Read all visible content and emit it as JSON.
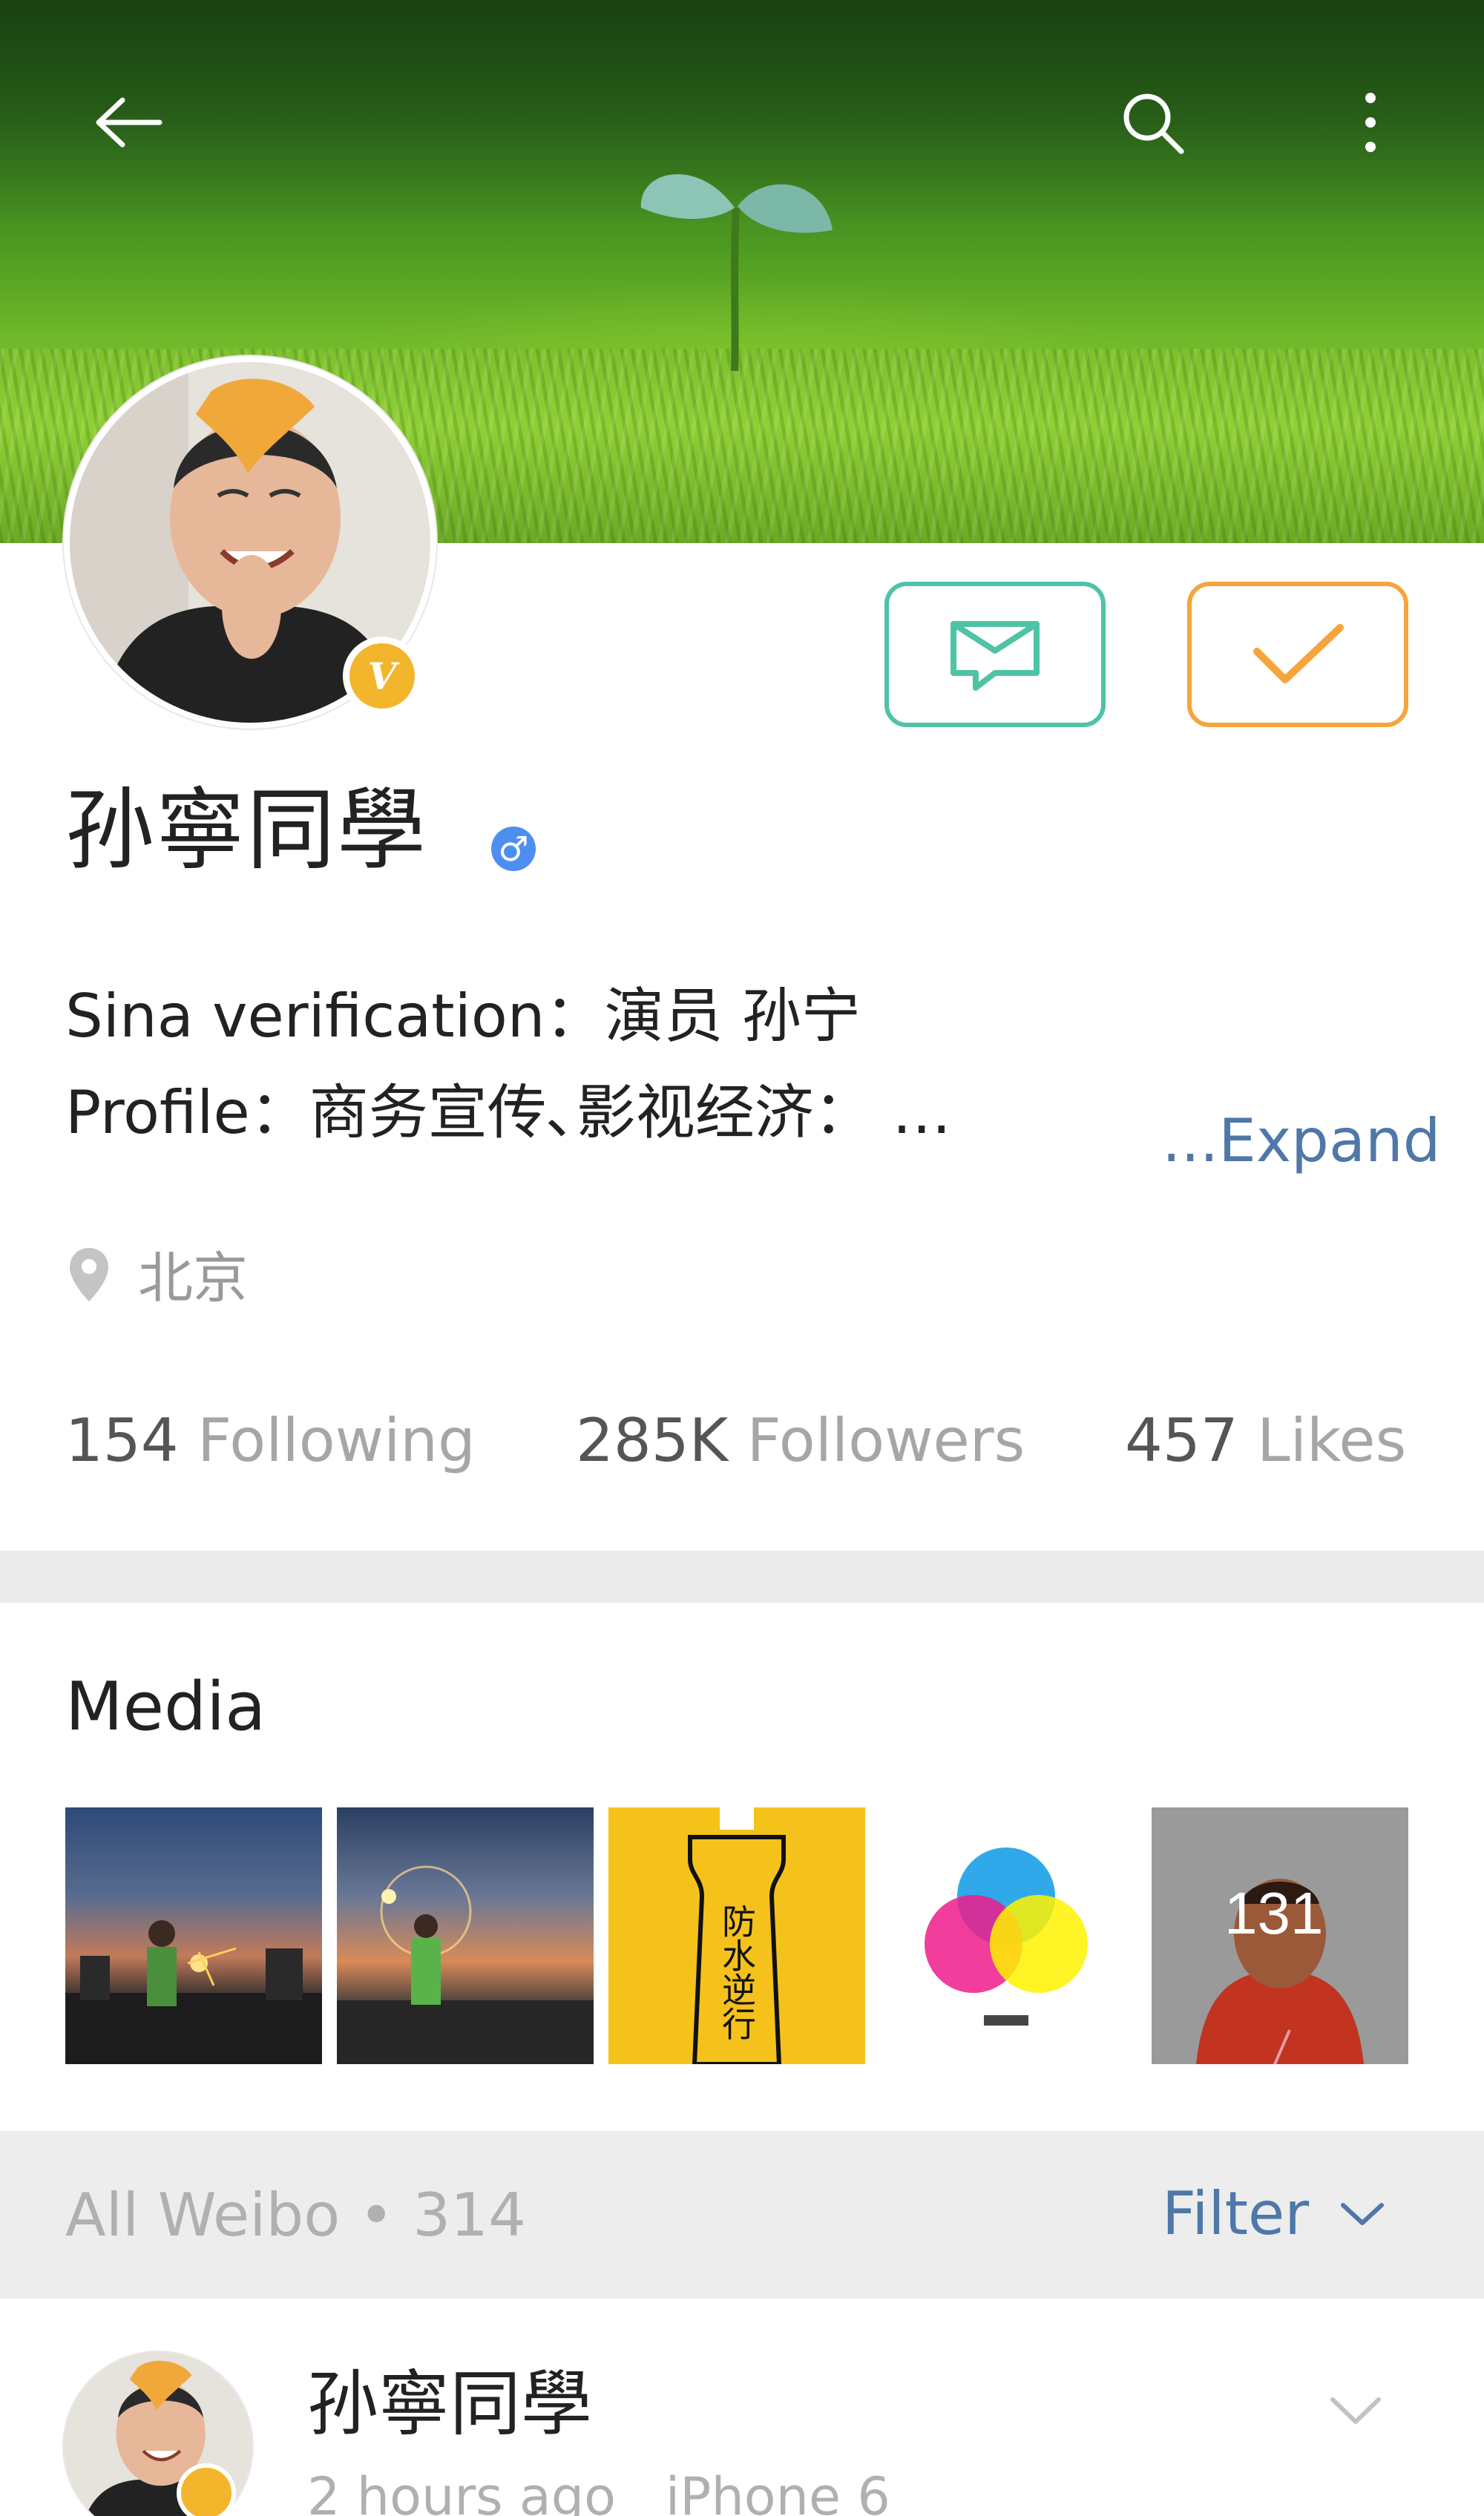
{
  "header": {
    "back_icon": "back-arrow-icon",
    "search_icon": "search-icon",
    "more_icon": "more-vertical-icon"
  },
  "profile": {
    "name": "孙寧同學",
    "verified_badge": "V",
    "gender_symbol": "♂",
    "verification": "Sina verification：演员 孙宁",
    "profile_line": "Profile：商务宣传､影视经济： …",
    "expand_label": "...Expand",
    "location": "北京"
  },
  "stats": {
    "following_count": "154",
    "following_label": "Following",
    "followers_count": "285K",
    "followers_label": "Followers",
    "likes_count": "457",
    "likes_label": "Likes"
  },
  "media": {
    "title": "Media",
    "thumb3_text": "防水逆行",
    "thumb5_text": "131"
  },
  "feed": {
    "all_weibo_label": "All Weibo",
    "separator": "•",
    "count": "314",
    "filter_label": "Filter"
  },
  "post": {
    "author": "孙寧同學",
    "time": "2 hours ago",
    "device": "iPhone 6"
  },
  "colors": {
    "message_button": "#4ec3a6",
    "follow_button": "#f6a43b",
    "link_blue": "#4f78a8",
    "verified_gold": "#f3b52b",
    "gender_blue": "#4d8ff0"
  }
}
